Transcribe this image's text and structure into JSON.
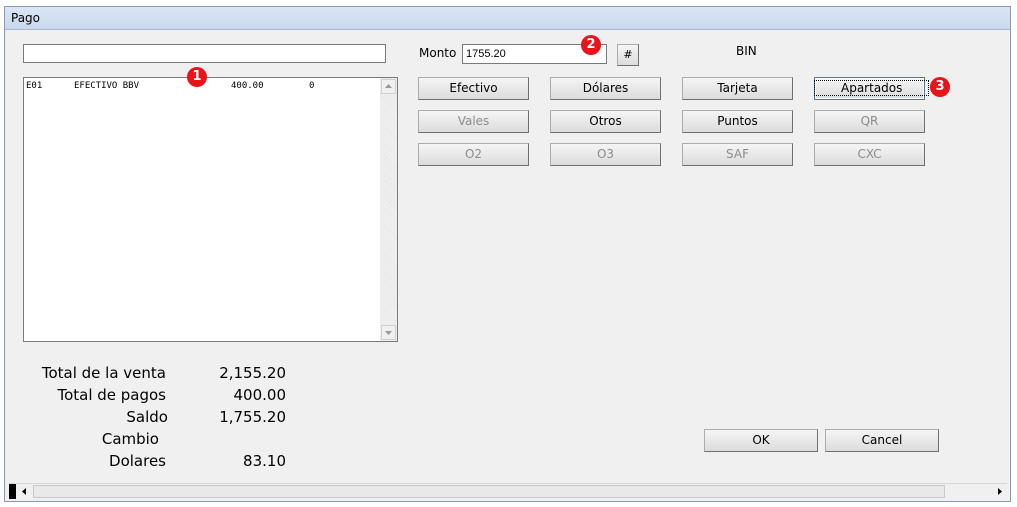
{
  "window": {
    "title": "Pago"
  },
  "filter_input": {
    "value": ""
  },
  "payments_list": {
    "rows": [
      {
        "code": "E01",
        "name": "EFECTIVO BBV",
        "amount": "400.00",
        "extra": "0"
      }
    ]
  },
  "monto": {
    "label": "Monto",
    "value": "1755.20",
    "hash_label": "#"
  },
  "bin_label": "BIN",
  "buttons": {
    "efectivo": "Efectivo",
    "dolares": "Dólares",
    "tarjeta": "Tarjeta",
    "apartados": "Apartados",
    "vales": "Vales",
    "otros": "Otros",
    "puntos": "Puntos",
    "qr": "QR",
    "o2": "O2",
    "o3": "O3",
    "saf": "SAF",
    "cxc": "CXC",
    "ok": "OK",
    "cancel": "Cancel"
  },
  "summary": {
    "total_venta_label": "Total de la venta",
    "total_venta_value": "2,155.20",
    "total_pagos_label": "Total de pagos",
    "total_pagos_value": "400.00",
    "saldo_label": "Saldo",
    "saldo_value": "1,755.20",
    "cambio_label": "Cambio",
    "cambio_value": "",
    "dolares_label": "Dolares",
    "dolares_value": "83.10"
  },
  "badges": {
    "b1": "1",
    "b2": "2",
    "b3": "3"
  },
  "colors": {
    "badge": "#e8141a",
    "titlebar": "#c9d8ee"
  }
}
